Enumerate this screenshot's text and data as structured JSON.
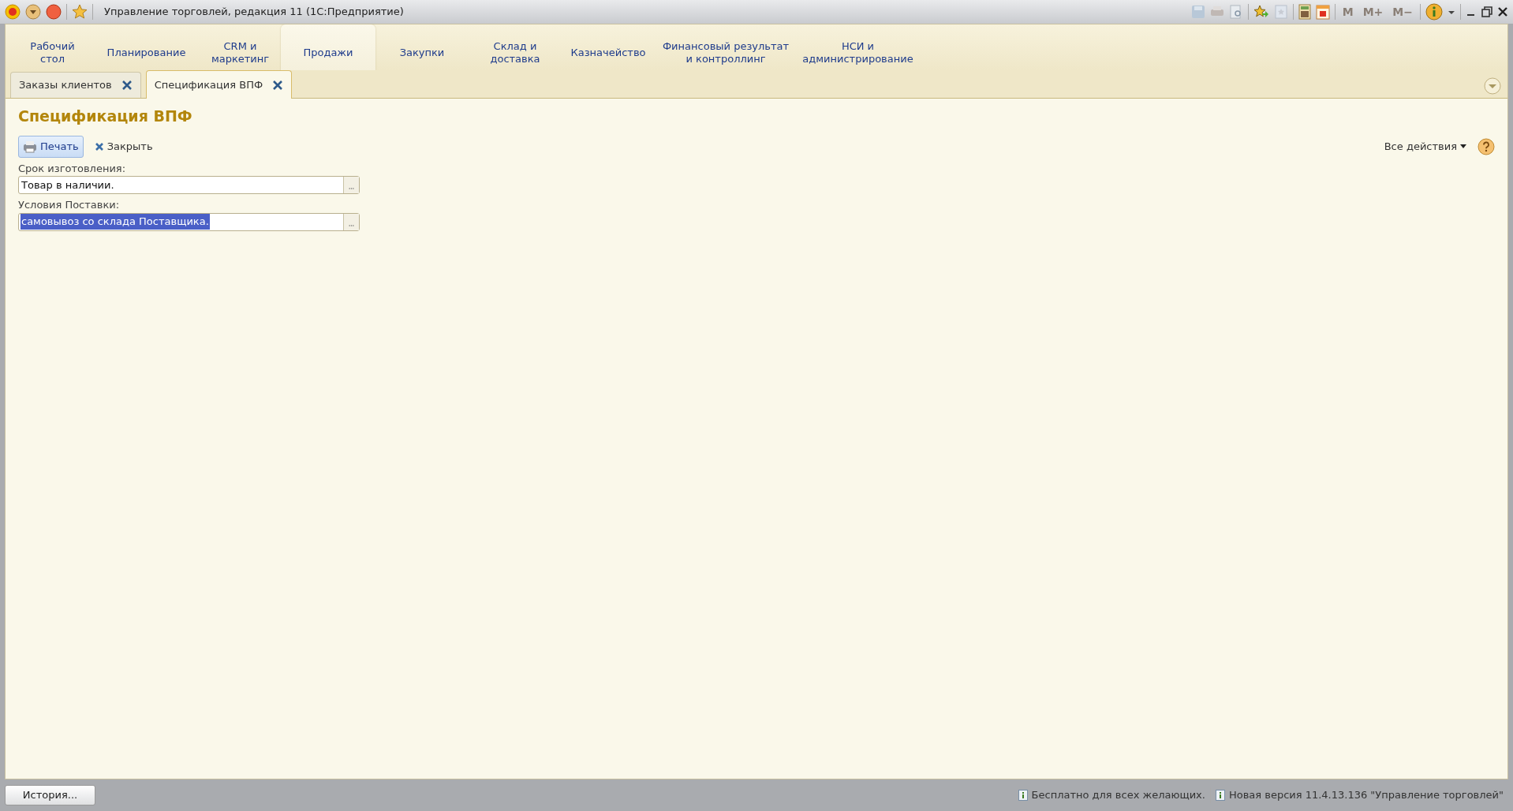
{
  "window": {
    "title": "Управление торговлей, редакция 11  (1С:Предприятие)"
  },
  "memory_buttons": [
    {
      "label": "M",
      "disabled": true
    },
    {
      "label": "M+",
      "disabled": true
    },
    {
      "label": "M−",
      "disabled": true
    }
  ],
  "sections": [
    {
      "label": "Рабочий стол",
      "selected": false
    },
    {
      "label": "Планирование",
      "selected": false
    },
    {
      "label": "CRM и маркетинг",
      "selected": false
    },
    {
      "label": "Продажи",
      "selected": true
    },
    {
      "label": "Закупки",
      "selected": false
    },
    {
      "label": "Склад и доставка",
      "selected": false
    },
    {
      "label": "Казначейство",
      "selected": false
    },
    {
      "label": "Финансовый результат и контроллинг",
      "selected": false
    },
    {
      "label": "НСИ и администрирование",
      "selected": false
    }
  ],
  "tabs": [
    {
      "label": "Заказы клиентов",
      "selected": false
    },
    {
      "label": "Спецификация ВПФ",
      "selected": true
    }
  ],
  "form": {
    "title": "Спецификация ВПФ",
    "buttons": [
      {
        "label": "Печать",
        "kind": "print"
      },
      {
        "label": "Закрыть",
        "kind": "close"
      }
    ],
    "all_actions": "Все действия",
    "fields": [
      {
        "label": "Срок изготовления:",
        "value": "Товар в наличии.",
        "selected": false
      },
      {
        "label": "Условия Поставки:",
        "value": "самовывоз со склада Поставщика.",
        "selected": true
      }
    ]
  },
  "history_button": "История...",
  "status_bar": [
    "Бесплатно для всех желающих.",
    "Новая версия 11.4.13.136 \"Управление торговлей\""
  ]
}
